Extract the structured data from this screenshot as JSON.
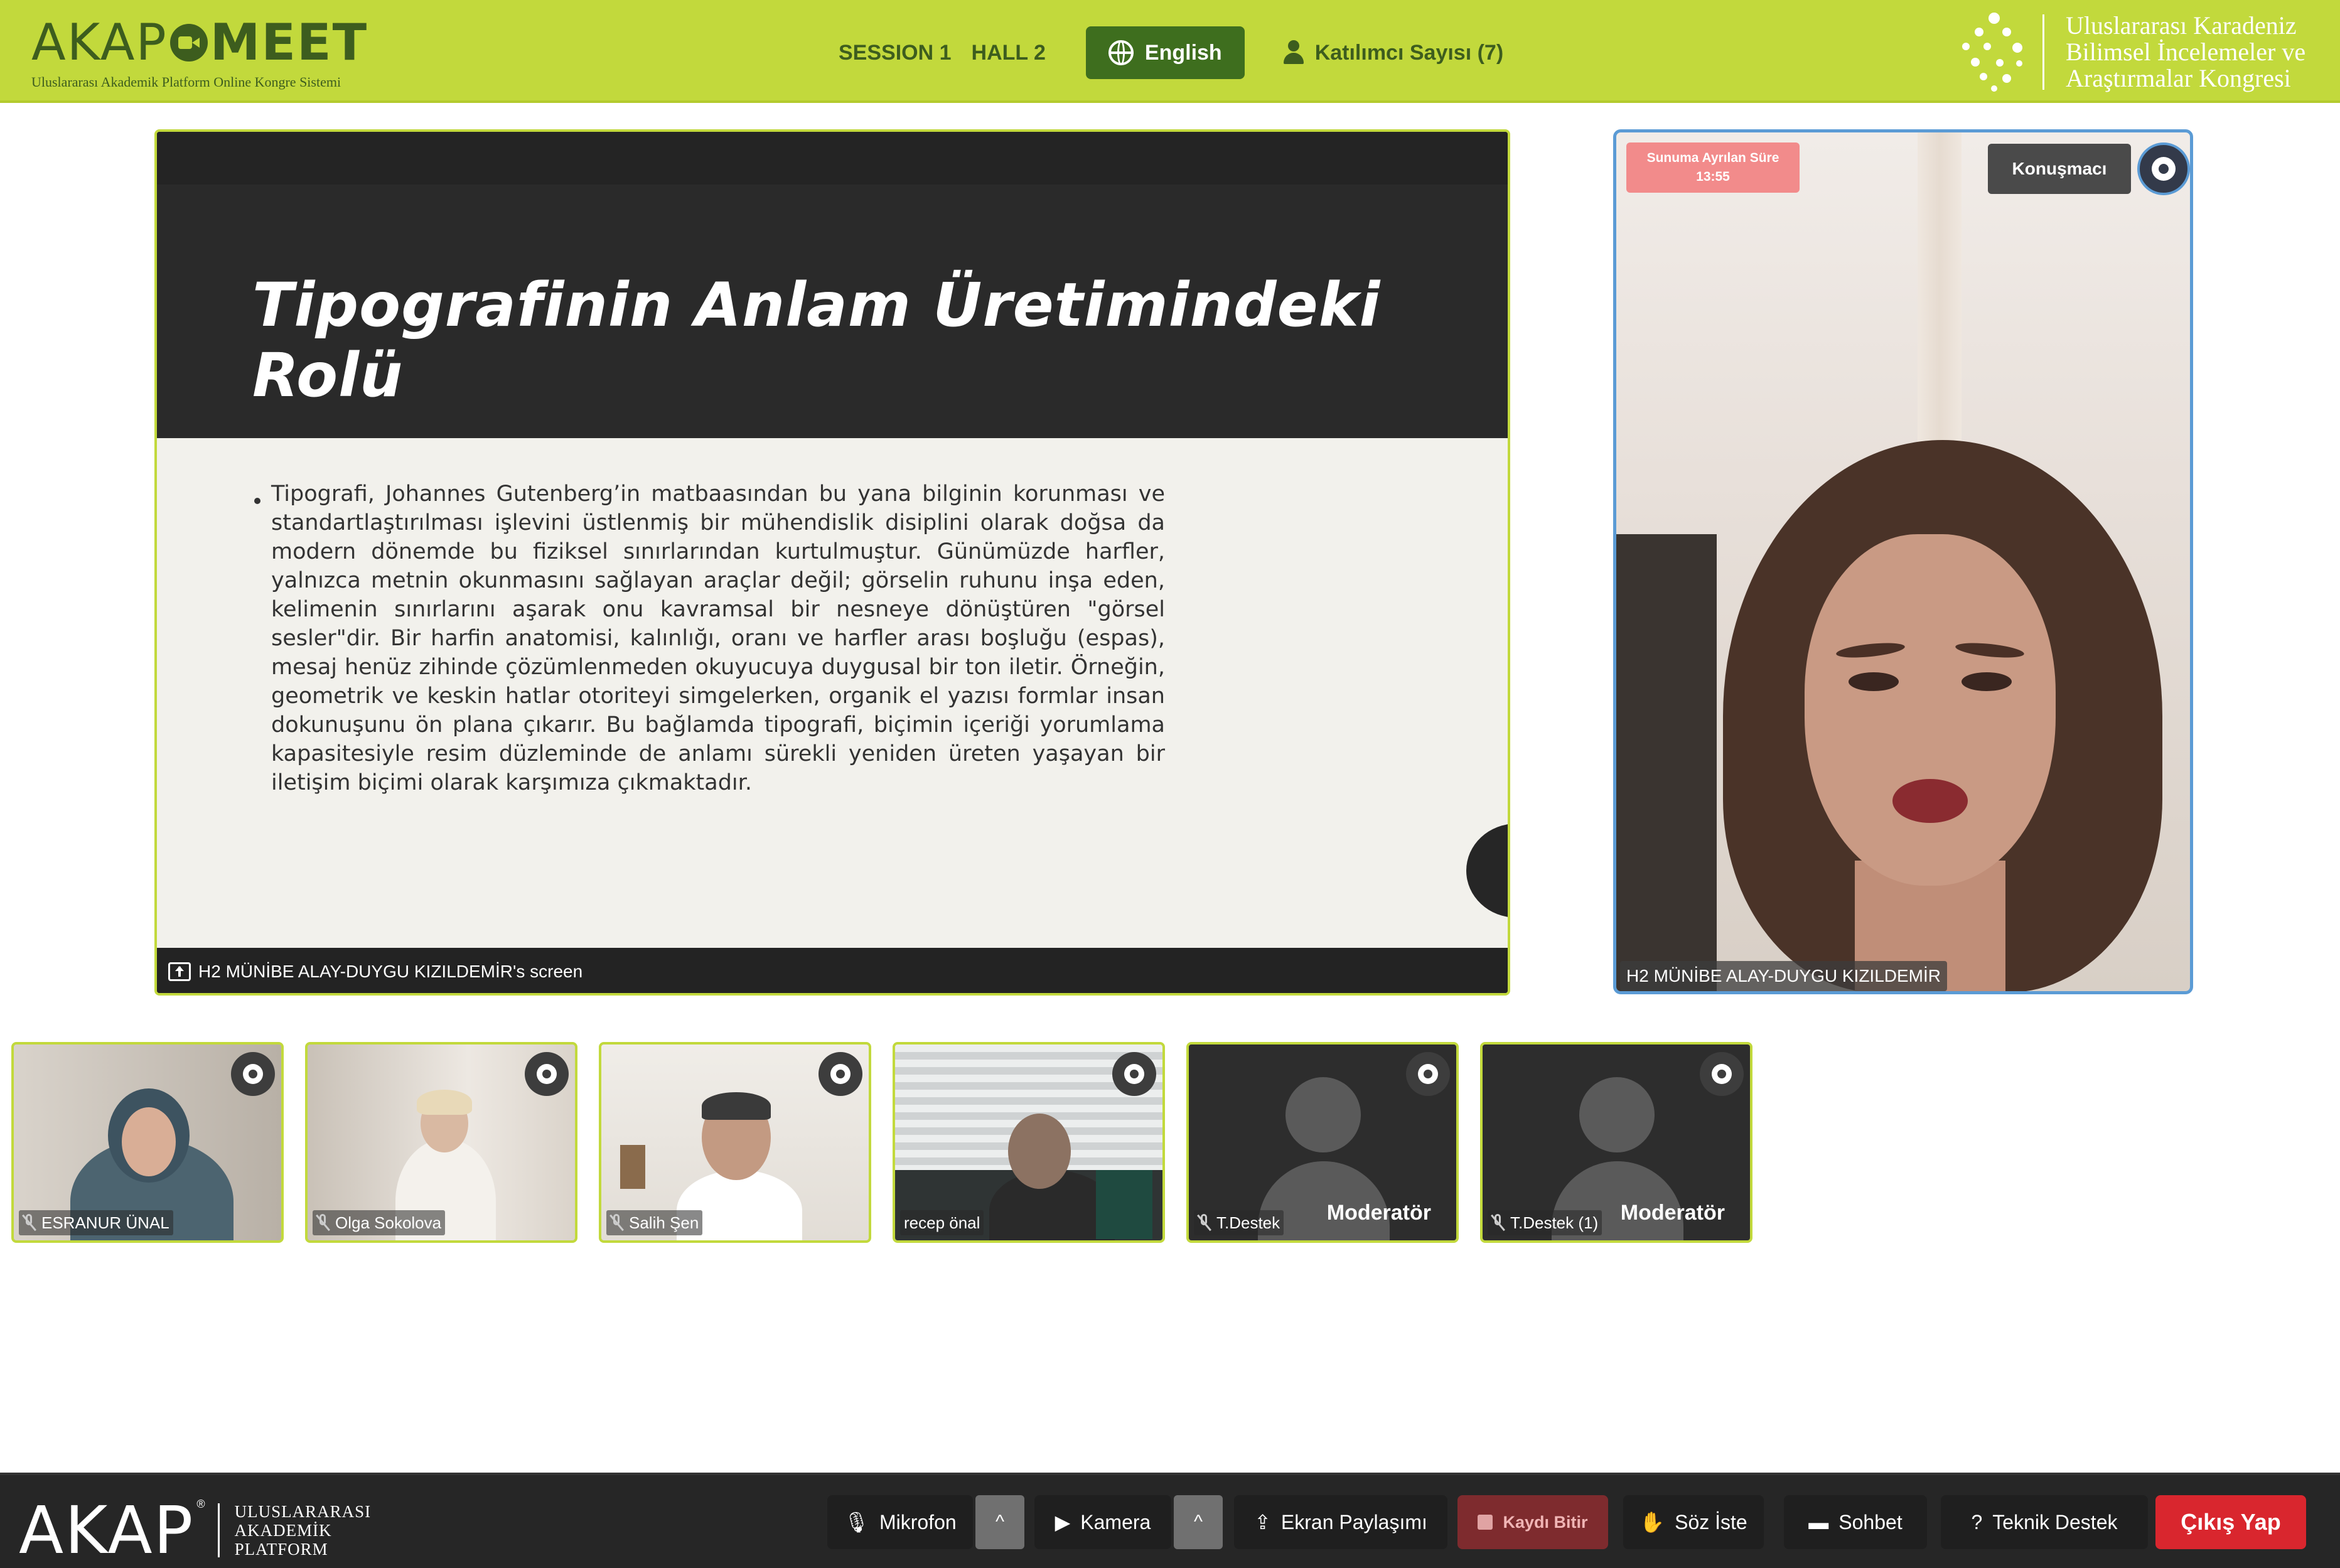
{
  "header": {
    "logo_left": "AKAP",
    "logo_right": "MEET",
    "logo_subtitle": "Uluslararası Akademik Platform Online Kongre Sistemi",
    "session": "SESSION 1",
    "hall": "HALL 2",
    "language": "English",
    "participants": "Katılımcı Sayısı (7)",
    "congress": {
      "line1": "Uluslararası Karadeniz",
      "line2": "Bilimsel İncelemeler ve",
      "line3": "Araştırmalar Kongresi"
    }
  },
  "presentation": {
    "slide_title": "Tipografinin Anlam Üretimindeki Rolü",
    "slide_text": "Tipografi, Johannes Gutenberg’in matbaasından bu yana bilginin korunması ve standartlaştırılması işlevini üstlenmiş bir mühendislik disiplini olarak doğsa da modern dönemde bu fiziksel sınırlarından kurtulmuştur. Günümüzde harfler, yalnızca metnin okunmasını sağlayan araçlar değil; görselin ruhunu inşa eden, kelimenin sınırlarını aşarak onu kavramsal bir nesneye dönüştüren \"görsel sesler\"dir. Bir harfin anatomisi, kalınlığı, oranı ve harfler arası boşluğu (espas), mesaj henüz zihinde çözümlenmeden okuyucuya duygusal bir ton iletir. Örneğin, geometrik ve keskin hatlar otoriteyi simgelerken, organik el yazısı formlar insan dokunuşunu ön plana çıkarır. Bu bağlamda tipografi, biçimin içeriği yorumlama kapasitesiyle resim düzleminde de anlamı sürekli yeniden üreten yaşayan bir iletişim biçimi olarak karşımıza çıkmaktadır.",
    "screen_label": "H2 MÜNİBE ALAY-DUYGU KIZILDEMİR's screen"
  },
  "speaker": {
    "time_label": "Sunuma Ayrılan Süre",
    "time_value": "13:55",
    "role": "Konuşmacı",
    "name": "H2 MÜNİBE ALAY-DUYGU KIZILDEMİR"
  },
  "participants": [
    {
      "name": "ESRANUR ÜNAL",
      "muted": true
    },
    {
      "name": "Olga Sokolova",
      "muted": true
    },
    {
      "name": "Salih Şen",
      "muted": true
    },
    {
      "name": "recep önal",
      "muted": false
    },
    {
      "name": "T.Destek",
      "muted": true,
      "badge": "Moderatör"
    },
    {
      "name": "T.Destek (1)",
      "muted": true,
      "badge": "Moderatör"
    }
  ],
  "bottombar": {
    "logo": "AKAP",
    "logo_reg": "®",
    "logo_sub1": "ULUSLARARASI",
    "logo_sub2": "AKADEMİK",
    "logo_sub3": "PLATFORM",
    "mic": "Mikrofon",
    "camera": "Kamera",
    "screen_share": "Ekran Paylaşımı",
    "stop_record": "Kaydı Bitir",
    "raise_hand": "Söz İste",
    "chat": "Sohbet",
    "support": "Teknik Destek",
    "exit": "Çıkış Yap",
    "arrow": "^"
  },
  "colors": {
    "accent": "#c2d93c",
    "header_text": "#3d5d1e",
    "exit": "#d9262e",
    "speaker_border": "#5b9bd5"
  }
}
